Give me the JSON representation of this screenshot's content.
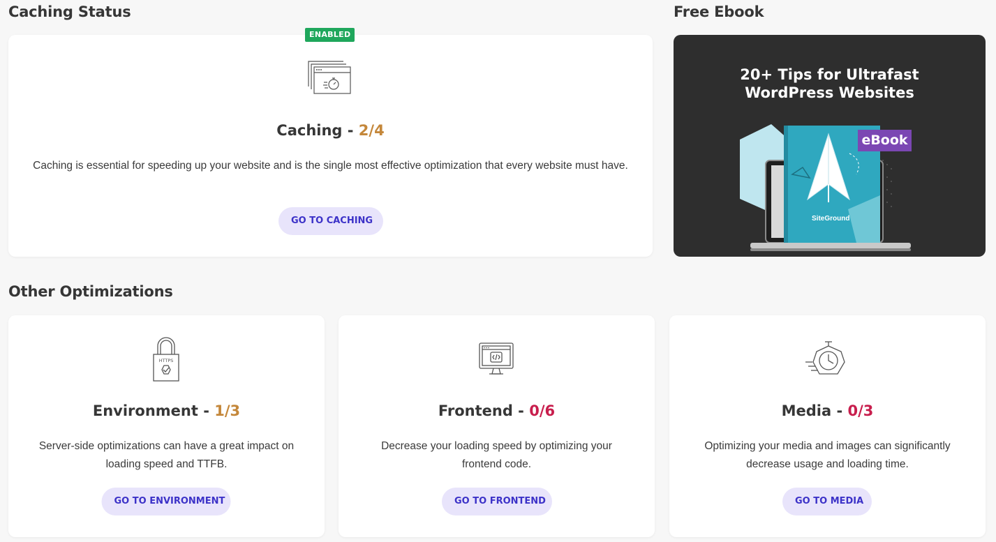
{
  "caching_section": {
    "title": "Caching Status",
    "badge": "ENABLED",
    "card_title": "Caching - ",
    "score": "2/4",
    "description": "Caching is essential for speeding up your website and is the single most effective optimization that every website must have.",
    "button": "GO TO CACHING",
    "icon": "caching-browser-icon"
  },
  "ebook_section": {
    "title": "Free Ebook",
    "banner_title": "20+ Tips for Ultrafast\nWordPress Websites",
    "label": "eBook",
    "brand": "SiteGround",
    "colors": {
      "background": "#2e2e2e",
      "book": "#2fa8bf",
      "label": "#7b47b3"
    }
  },
  "other_section": {
    "title": "Other Optimizations",
    "cards": [
      {
        "card_title": "Environment - ",
        "score": "1/3",
        "score_color": "#c4873a",
        "description": "Server-side optimizations can have a great impact on loading speed and TTFB.",
        "button": "GO TO ENVIRONMENT",
        "icon": "https-lock-icon",
        "icon_text": "HTTPS"
      },
      {
        "card_title": "Frontend - ",
        "score": "0/6",
        "score_color": "#c81e4d",
        "description": "Decrease your loading speed by optimizing your frontend code.",
        "button": "GO TO FRONTEND",
        "icon": "code-monitor-icon"
      },
      {
        "card_title": "Media - ",
        "score": "0/3",
        "score_color": "#c81e4d",
        "description": "Optimizing your media and images can significantly decrease usage and loading time.",
        "button": "GO TO MEDIA",
        "icon": "stopwatch-icon"
      }
    ]
  },
  "colors": {
    "button_bg": "#e8e4fb",
    "button_text": "#3c32c8",
    "badge_green": "#1fa75c",
    "score_orange": "#c4873a",
    "score_red": "#c81e4d"
  }
}
